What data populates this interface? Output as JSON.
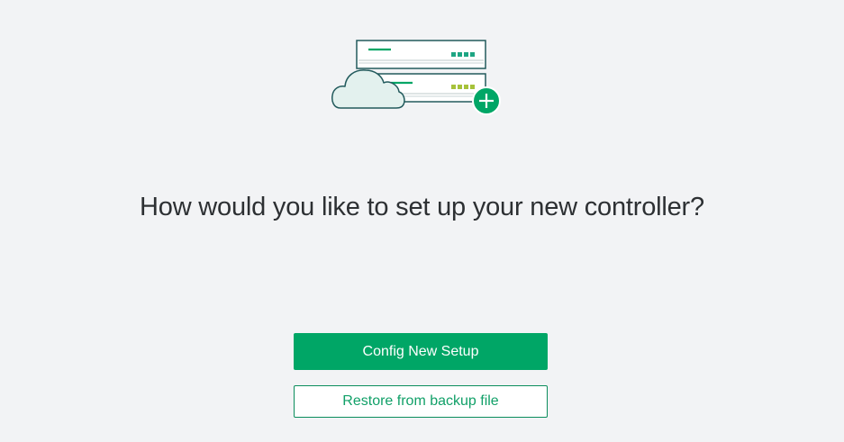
{
  "illustration": {
    "icon": "controller-cloud-add-icon",
    "accent_color": "#00a666",
    "outline_color": "#225a5c"
  },
  "headline": "How would you like to set up your new controller?",
  "buttons": {
    "primary_label": "Config New Setup",
    "secondary_label": "Restore from backup file"
  }
}
